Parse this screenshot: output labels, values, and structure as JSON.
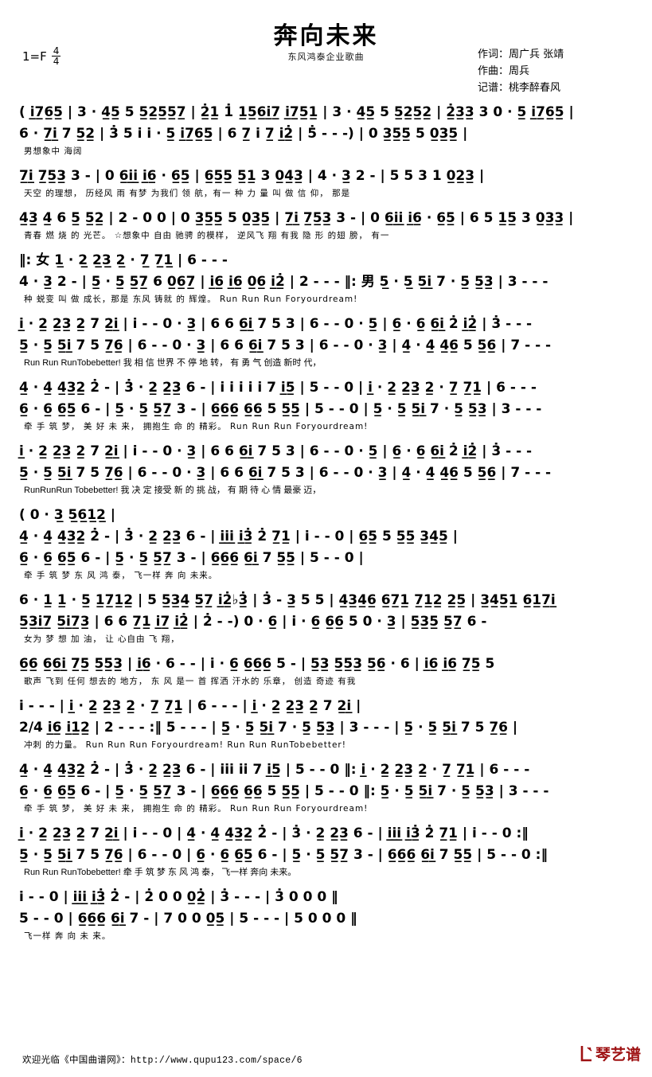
{
  "header": {
    "title": "奔向未来",
    "subtitle": "东风鸿泰企业歌曲",
    "key_label": "1=F",
    "meter_num": "4",
    "meter_den": "4",
    "credits": [
      "作词：周广兵 张靖",
      "作曲：周兵",
      "记谱：桃李醉春风"
    ]
  },
  "score": {
    "lines": [
      {
        "id": "l01",
        "type": "notes",
        "text": "( i̲7̲6̲5̲ | 3 · 4̲5̲ 5 5̲2̲5̲5̲7̲ | 2̲̇1̲ 1̇ 1̲5̲6̲i̲7̲ i̲7̲5̲1̲ | 3 · 4̲5̲ 5  5̲2̲5̲2̲ | 2̲̇3̲3̲ 3 0 · 5̲ i̲7̲6̲5̲ |"
      },
      {
        "id": "l02",
        "type": "notes",
        "text": "6 · 7̲i̲ 7 5̲2̲ | 3̇ 5 i̇ i̇ · 5̲ i̲7̲6̲5̲ | 6 7̲ i̇ 7̲ i̲2̲̇ | 5̇ -  -  -) | 0 3̲5̲5̲ 5 0̲3̲5̲ |"
      },
      {
        "id": "l02b",
        "type": "lyrics",
        "text": "男想象中               海阔"
      },
      {
        "id": "l03",
        "type": "notes",
        "text": "7̲i̲ 7̲5̲3̲ 3 - | 0 6̲i̲i̲ i̲6̲ · 6̲5̲ | 6̲5̲5̲ 5̲1̲ 3 0̲4̲3̲ | 4 · 3̲ 2 - | 5 5 3 1 0̲2̲3̲ |"
      },
      {
        "id": "l03b",
        "type": "lyrics",
        "text": "天空 的理想，      历经风 雨 有梦 为我们 领 航，有一 种   力 量    叫 做 信 仰， 那是"
      },
      {
        "id": "l04",
        "type": "notes",
        "text": "4̲3̲ 4̲ 6 5̲ 5̲2̲ | 2 - 0 0 | 0 3̲5̲5̲ 5 0̲3̲5̲ | 7̲i̲ 7̲5̲3̲ 3 - | 0 6̲i̲i̲ i̲6̲ · 6̲5̲ | 6 5 1̲5̲ 3 0̲3̲3̲ |"
      },
      {
        "id": "l04b",
        "type": "lyrics",
        "text": "青春 燃 烧 的 光芒。   ☆想象中      自由   驰骋 的模样，      逆风飞 翔  有我  隐 形 的翅 膀， 有一"
      },
      {
        "id": "l05a",
        "type": "notes_upper",
        "text": "‖: 女 1̲ · 2̲ 2̲3̲ 2̲ · 7̲ 7̲1̲ | 6 - - -"
      },
      {
        "id": "l05",
        "type": "notes",
        "text": "4 · 3̲ 2 - | 5̲ · 5̲ 5̲7̲ 6 0̲6̲7̲ | i̲̇6̲ i̲̇6̲ 0̲6̲ i̲2̲̇ | 2 - - - ‖: 男 5̲ · 5̲ 5̲i̲̇ 7 · 5̲ 5̲3̲ | 3 - - -"
      },
      {
        "id": "l05b",
        "type": "lyrics",
        "text": "种  蜕变   叫 做 成长，那是  东风 铸就  的 辉煌。            Run Run Run Foryourdream!"
      },
      {
        "id": "l06",
        "type": "notes",
        "text": "i̲ · 2̲ 2̲3̲ 2̲ 7 2̲i̲ | i̇ - - 0 · 3̲ | 6 6 6̲i̲ 7 5 3 | 6 - - 0 · 5̲ | 6̲ · 6̲ 6̲i̲ 2̇ i̲2̲̇ | 3̇ - - -"
      },
      {
        "id": "l07",
        "type": "notes",
        "text": "5̲ · 5̲ 5̲i̲̇ 7 5 7̲6̲ | 6 - - 0 · 3̲ | 6 6 6̲i̲ 7 5 3 | 6 - - 0 · 3̲ | 4̲ · 4̲ 4̲6̲ 5 5̲6̲ | 7 - - -"
      },
      {
        "id": "l07b",
        "type": "lyrics_latin",
        "text": "Run Run RunTobebetter!              我   相 信 世界 不 停 地  转，     有  勇 气 创造 新时  代，"
      },
      {
        "id": "l08",
        "type": "notes",
        "text": "4̲ · 4̲ 4̲3̲2̲ 2̇ - | 3̇ · 2̲ 2̲3̲ 6 - | i̇ i̇ i̇ i̇ i̇ 7 i̲5̲ | 5 - - 0 | i̲ · 2̲ 2̲3̲ 2̲ · 7̲ 7̲1̲ | 6 - - -"
      },
      {
        "id": "l09",
        "type": "notes",
        "text": "6̲ · 6̲ 6̲5̲ 6 - | 5̲ · 5̲ 5̲7̲ 3 - | 6̲6̲6̲ 6̲6̲ 5 5̲5̲ | 5 - - 0 | 5̲ · 5̲ 5̲i̲̇ 7 · 5̲ 5̲3̲ | 3 - - -"
      },
      {
        "id": "l09b",
        "type": "lyrics",
        "text": "牵 手 筑 梦，  美 好 未 来，  拥抱生 命 的 精彩。       Run Run Run Foryourdream!"
      },
      {
        "id": "l10",
        "type": "notes",
        "text": "i̲ · 2̲ 2̲3̲ 2̲ 7 2̲i̲ | i̇ - - 0 · 3̲ | 6 6 6̲i̲ 7 5 3 | 6 - - 0 · 5̲ | 6̲ · 6̲ 6̲i̲ 2̇ i̲2̲̇ | 3̇ - - -"
      },
      {
        "id": "l11",
        "type": "notes",
        "text": "5̲ · 5̲ 5̲i̲̇ 7 5 7̲6̲ | 6 - - 0 · 3̲ | 6 6 6̲i̲ 7 5 3 | 6 - - 0 · 3̲ | 4̲ · 4̲ 4̲6̲ 5 5̲6̲ | 7 - - -"
      },
      {
        "id": "l11b",
        "type": "lyrics_latin",
        "text": "RunRunRun Tobebetter!               我   决 定 接受 新 的 挑   战，     有  期 待  心 情 最豪   迈，"
      },
      {
        "id": "l12a",
        "type": "bracket1",
        "text": "( 0 · 3̲ 5̲6̲1̲2̲ |"
      },
      {
        "id": "l12",
        "type": "notes",
        "text": "4̲ · 4̲ 4̲3̲2̲ 2̇ - | 3̇ · 2̲ 2̲3̲ 6 - | i̲i̲̇i̲̇ i̲3̲̇ 2̇ 7̲1̲ | i̇ - -   0   | 6̲5̲ 5 5̲5̲ 3̲4̲5̲ |"
      },
      {
        "id": "l13",
        "type": "notes",
        "text": "6̲ · 6̲ 6̲5̲ 6 - | 5̲ · 5̲ 5̲7̲ 3 - | 6̲6̲6̲ 6̲i̲̇ 7 5̲5̲ | 5 - -   0   |"
      },
      {
        "id": "l13b",
        "type": "lyrics",
        "text": "牵 手 筑 梦  东 风 鸿 泰，  飞一样 奔 向 未来。"
      },
      {
        "id": "l14",
        "type": "notes",
        "text": "6 · 1̲ 1̲ · 5̲ 1̲7̲1̲2̲ | 5 5̲3̲4̲ 5̲7̲ i̲2̲̇♭3̲̇ | 3̇ - 3̲ 5 5 | 4̲3̲4̲6̲ 6̲7̲1̲ 7̲1̲2̲ 2̲5̲ | 3̲4̲5̲1̲ 6̲1̲7̲i̲"
      },
      {
        "id": "l15",
        "type": "notes",
        "text": "5̲3̲i̲7̲ 5̲i̲7̲3̲ | 6 6 7̲1̲ i̲7̲ i̲2̲̇ | 2̇ - -) 0 · 6̲ | i̇ · 6̲ 6̲6̲ 5 0 · 3̲ | 5̲3̲5̲ 5̲7̲ 6 -"
      },
      {
        "id": "l15b",
        "type": "lyrics",
        "text": "                                         女为 梦 想 加 油， 让 心自由 飞 翔，"
      },
      {
        "id": "l16",
        "type": "notes",
        "text": "6̲6̲ 6̲6̲i̲ 7̲5̲ 5̲5̲3̲ | i̲6̲ · 6 - - | i̇ · 6̲ 6̲6̲6̲ 5 - | 5̲3̲ 5̲5̲3̲ 5̲6̲ · 6 | i̲6̲ i̲6̲ 7̲5̲ 5"
      },
      {
        "id": "l16b",
        "type": "lyrics",
        "text": "歌声 飞到   任何 想去的  地方，        东 风  是一 首    挥洒 汗水的 乐章，     创造 奇迹 有我"
      },
      {
        "id": "l17a",
        "type": "bracket2_upper",
        "text": "i̇ - - - | i̲ · 2̲ 2̲3̲ 2̲ · 7̲ 7̲1̲ | 6 - - - | i̲ · 2̲ 2̲3̲ 2̲ 7 2̲i̲ |"
      },
      {
        "id": "l17",
        "type": "notes",
        "text": "2/4 i̲6̲ i̲1̲2̲ | 2 - - - :‖ 5 - - - | 5̲ · 5̲ 5̲i̲̇ 7 · 5̲ 5̲3̲ | 3 - - - | 5̲ · 5̲ 5̲i̲̇ 7 5 7̲6̲ |"
      },
      {
        "id": "l17b",
        "type": "lyrics",
        "text": "冲刺  的力量。          Run Run Run Foryourdream!        Run Run RunTobebetter!"
      },
      {
        "id": "l18",
        "type": "notes",
        "text": "4̲ · 4̲ 4̲3̲2̲ 2̇ -  | 3̇ · 2̲ 2̲3̲ 6 - | i̇i̇i̇ i̇i̇ 7 i̲5̲ | 5 - - 0 ‖: i̲ · 2̲ 2̲3̲ 2̲ · 7̲ 7̲1̲ | 6 - - -"
      },
      {
        "id": "l19",
        "type": "notes",
        "text": "6̲ · 6̲ 6̲5̲ 6 - | 5̲ · 5̲ 5̲7̲ 3 - | 6̲6̲6̲ 6̲6̲ 5 5̲5̲ | 5 - - 0 ‖: 5̲ · 5̲ 5̲i̲̇ 7 · 5̲ 5̲3̲ | 3 - - -"
      },
      {
        "id": "l19b",
        "type": "lyrics",
        "text": "牵 手 筑 梦，  美 好 未 来，  拥抱生 命 的 精彩。       Run Run Run Foryourdream!"
      },
      {
        "id": "l20",
        "type": "notes",
        "text": "i̲ · 2̲ 2̲3̲ 2̲ 7 2̲i̲ | i̇ - - 0 | 4̲ · 4̲ 4̲3̲2̲ 2̇ - | 3̇ · 2̲ 2̲3̲ 6 - | i̲i̲̇i̲̇ i̲3̲̇ 2̇ 7̲1̲ | i̇ - - 0 :‖"
      },
      {
        "id": "l21",
        "type": "notes",
        "text": "5̲ · 5̲ 5̲i̲̇ 7 5 7̲6̲ | 6 - - 0 | 6̲ · 6̲ 6̲5̲ 6 - | 5̲ · 5̲ 5̲7̲ 3 - | 6̲6̲6̲ 6̲i̲̇ 7 5̲5̲ | 5 - - 0 :‖"
      },
      {
        "id": "l21b",
        "type": "lyrics_latin",
        "text": "Run Run RunTobebetter!          牵 手 筑 梦   东 风  鸿 泰，   飞一样  奔向 未来。"
      },
      {
        "id": "l22",
        "type": "notes",
        "text": "i̇ - - 0 | i̲i̲̇i̲̇ i̲3̲̇ 2̇ - | 2̇ 0 0 0̲2̲̇ | 3̇ - - - | 3̇ 0 0 0 ‖"
      },
      {
        "id": "l23",
        "type": "notes",
        "text": "5 - - 0 | 6̲6̲6̲ 6̲i̲ 7 - | 7 0 0 0̲5̲ | 5 - - - | 5 0 0 0 ‖"
      },
      {
        "id": "l23b",
        "type": "lyrics",
        "text": "       飞一样  奔 向       未  来。"
      }
    ]
  },
  "endings": {
    "first": "1",
    "second": "2"
  },
  "footer": {
    "text": "欢迎光临《中国曲谱网》：http://www.qupu123.com/space/6",
    "logo_text": "琴艺谱",
    "logo_color": "#9e1112"
  }
}
